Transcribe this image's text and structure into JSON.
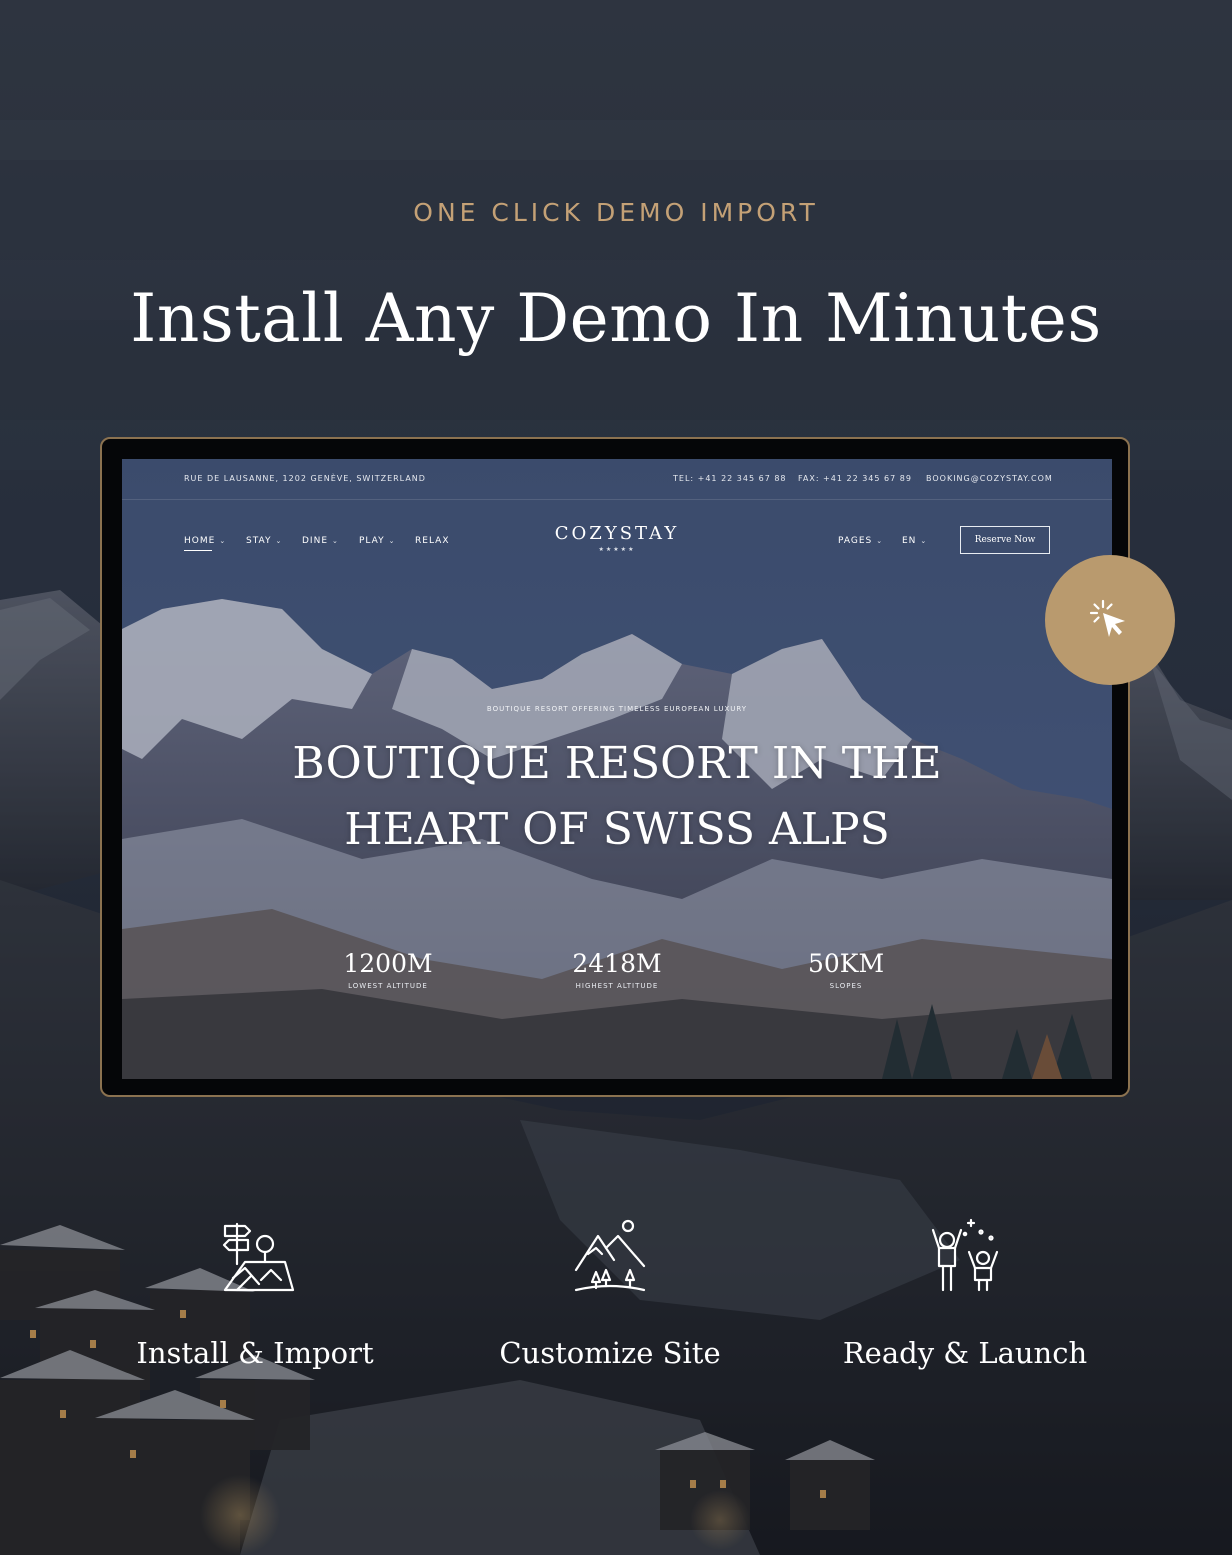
{
  "header": {
    "eyebrow": "ONE CLICK DEMO IMPORT",
    "title": "Install Any Demo In Minutes"
  },
  "preview": {
    "topbar": {
      "address": "RUE DE LAUSANNE, 1202 GENÈVE, SWITZERLAND",
      "tel": "TEL: +41 22 345 67 88",
      "fax": "FAX: +41 22 345 67 89",
      "email": "BOOKING@COZYSTAY.COM"
    },
    "nav": {
      "home": "HOME",
      "stay": "STAY",
      "dine": "DINE",
      "play": "PLAY",
      "relax": "RELAX",
      "pages": "PAGES",
      "lang": "EN",
      "caret": "⌄"
    },
    "logo": {
      "text": "COZYSTAY",
      "stars": "★★★★★"
    },
    "reserve_label": "Reserve Now",
    "hero": {
      "subtitle": "BOUTIQUE RESORT OFFERING TIMELESS EUROPEAN LUXURY",
      "title_line1": "BOUTIQUE RESORT IN THE",
      "title_line2": "HEART OF SWISS ALPS"
    },
    "stats": [
      {
        "value": "1200M",
        "label": "LOWEST ALTITUDE"
      },
      {
        "value": "2418M",
        "label": "HIGHEST ALTITUDE"
      },
      {
        "value": "50KM",
        "label": "SLOPES"
      }
    ]
  },
  "click_badge": {
    "icon": "cursor-click-icon",
    "color": "#b99a6e"
  },
  "steps": [
    {
      "icon": "signpost-map-icon",
      "label": "Install & Import"
    },
    {
      "icon": "mountains-icon",
      "label": "Customize Site"
    },
    {
      "icon": "celebration-icon",
      "label": "Ready & Launch"
    }
  ],
  "colors": {
    "accent": "#c4a176",
    "frame_border": "#8b7250",
    "background": "#1e2430"
  }
}
